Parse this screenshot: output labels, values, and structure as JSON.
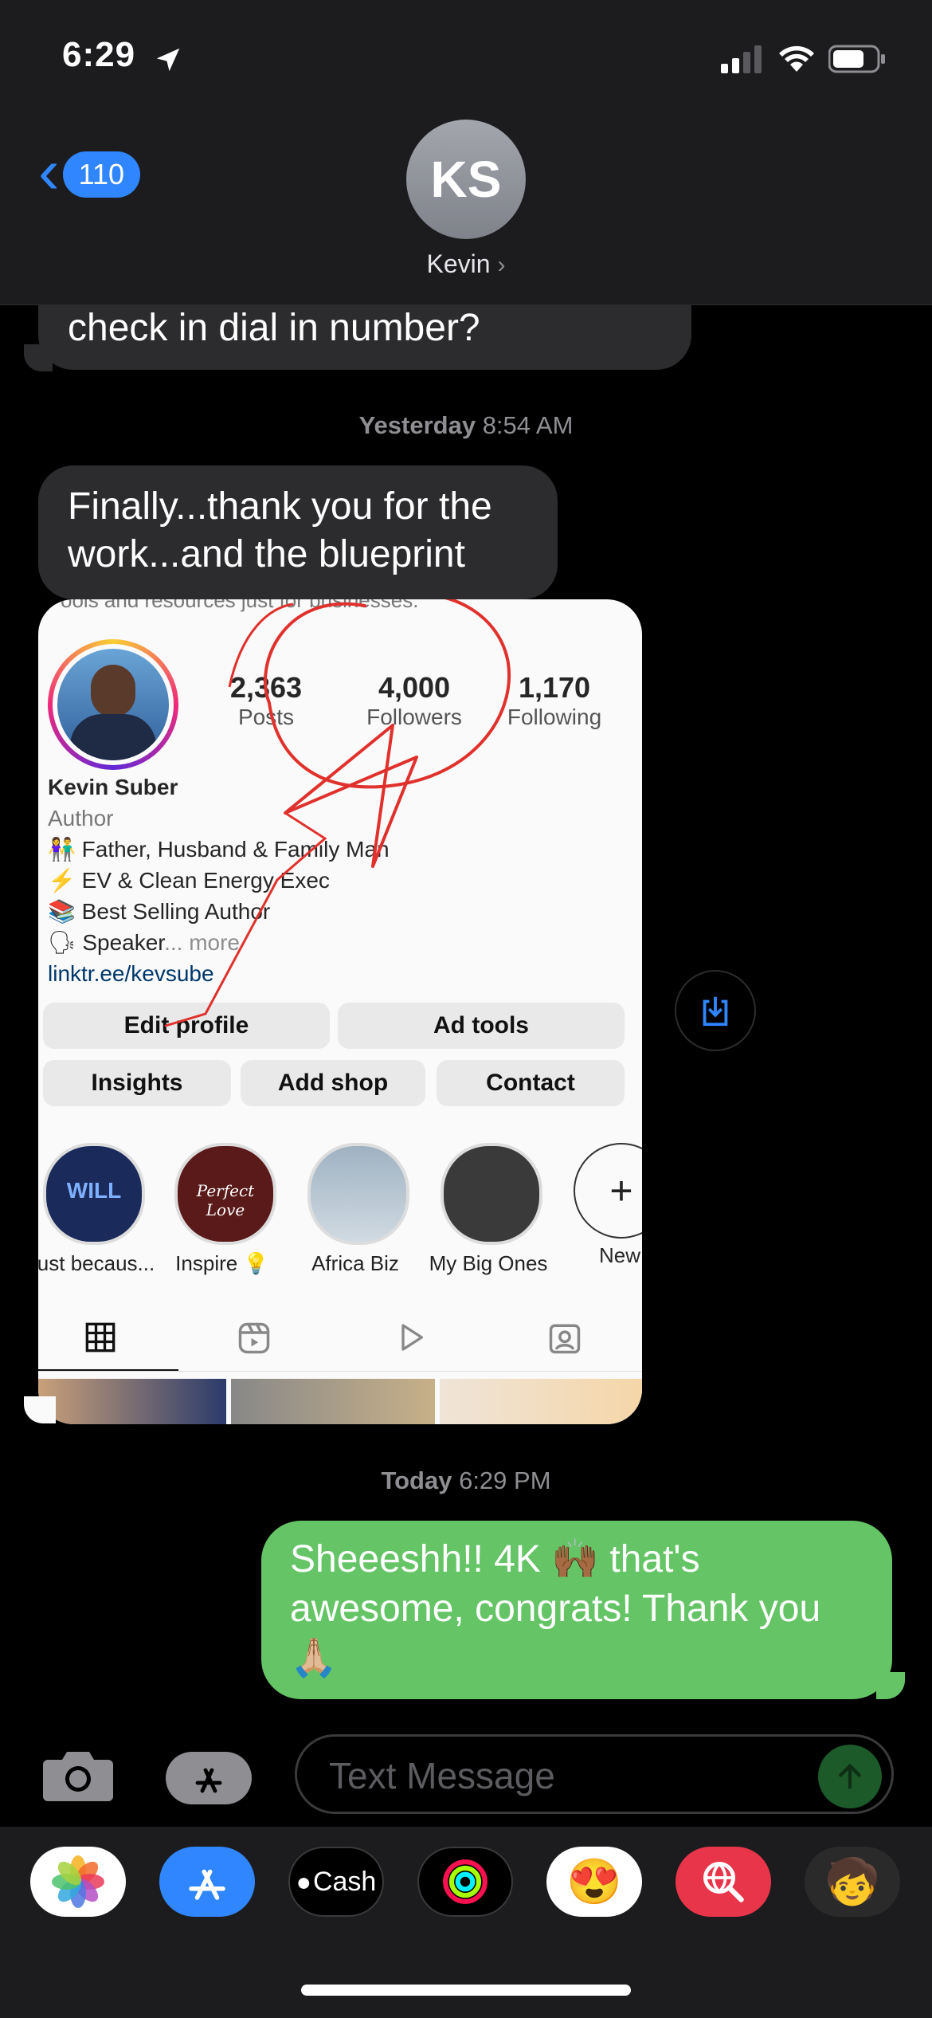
{
  "status_bar": {
    "time": "6:29"
  },
  "header": {
    "back_badge": "110",
    "avatar_initials": "KS",
    "contact_name": "Kevin"
  },
  "messages": {
    "prev_incoming": "check in dial in number?",
    "timestamp_1": {
      "day": "Yesterday",
      "time": "8:54 AM"
    },
    "incoming_1_line1": "Finally...thank you for the",
    "incoming_1_line2": "work...and the blueprint",
    "timestamp_2": {
      "day": "Today",
      "time": "6:29 PM"
    },
    "outgoing_line1": "Sheeeshh!! 4K 🙌🏾 that's",
    "outgoing_line2": "awesome, congrats! Thank you",
    "outgoing_line3": "🙏🏼"
  },
  "instagram": {
    "top_snippet": "ools and resources just for businesses.",
    "stats": [
      {
        "value": "2,363",
        "label": "Posts"
      },
      {
        "value": "4,000",
        "label": "Followers"
      },
      {
        "value": "1,170",
        "label": "Following"
      }
    ],
    "name": "Kevin Suber",
    "category": "Author",
    "bio": [
      "👫 Father, Husband & Family Man",
      "⚡ EV & Clean Energy Exec",
      "📚 Best Selling Author",
      "🗣 Speaker"
    ],
    "more": "... more",
    "link": "linktr.ee/kevsube",
    "buttons_row1": [
      "Edit profile",
      "Ad tools"
    ],
    "buttons_row2": [
      "Insights",
      "Add shop",
      "Contact"
    ],
    "highlights": [
      "Just becaus...",
      "Inspire 💡",
      "Africa Biz",
      "My Big Ones",
      "New"
    ],
    "highlight_texts": [
      "WILL",
      "Perfect Love"
    ]
  },
  "composer": {
    "placeholder": "Text Message"
  },
  "apps": [
    "Photos",
    "App Store",
    "Cash",
    "Fitness",
    "Memoji Stickers",
    "Search Images",
    "Memoji"
  ],
  "apps_cash_label": "Cash",
  "colors": {
    "accent": "#2f86ff",
    "sent_bubble": "#64c466",
    "received_bubble": "#2c2c2e",
    "annotation": "#e0312c"
  }
}
